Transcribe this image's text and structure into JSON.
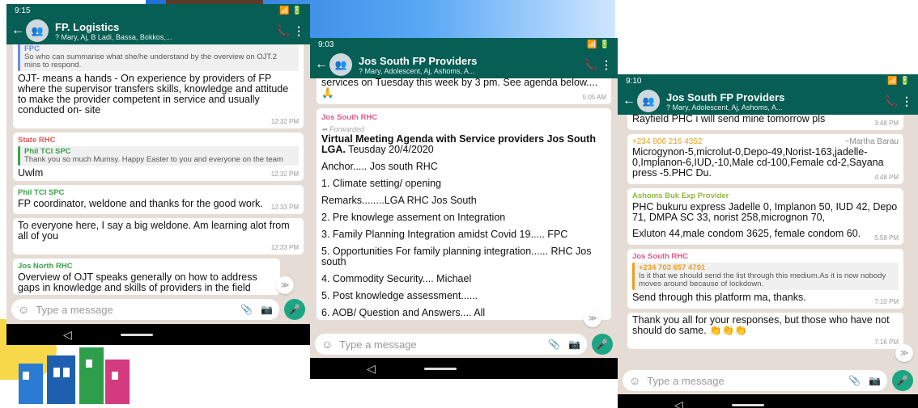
{
  "left": {
    "status_time": "9:15",
    "status_right": "ᵍᴼᴿᵃᴿ",
    "title": "FP. Logistics",
    "subtitle": "? Mary, Aj, B Ladi, Bassa, Bokkos,...",
    "m1_quote_sender": "FPC",
    "m1_quote": "So who can summarise what she/he understand by  the overview on OJT.2 mins to respond.",
    "m1_text": "OJT- means a hands - On experience by providers of FP where the supervisor transfers skills, knowledge and attitude to make the provider competent in service and usually conducted on- site",
    "m1_time": "12:32 PM",
    "m2_sender": "State RHC",
    "m2_quote_sender": "Phil TCI SPC",
    "m2_quote": "Thank you so much Mumsy. Happy Easter to you and everyone on the team",
    "m2_text": "Uwlm",
    "m2_time": "12:32 PM",
    "m3_sender": "Phil TCI SPC",
    "m3_text": "FP coordinator, weldone and thanks for the good work.",
    "m3_time": "12:33 PM",
    "m4_text": "To everyone here, I say a big weldone. Am learning alot from all of you",
    "m4_time": "12:33 PM",
    "m5_sender": "Jos North RHC",
    "m5_text": "Overview of OJT speaks generally on how to address gaps in knowledge and skills of providers in the field",
    "placeholder": "Type a message"
  },
  "middle": {
    "status_time": "9:03",
    "title": "Jos South FP Providers",
    "subtitle": "? Mary, Adolescent, Aj, Ashoms, A...",
    "m0_text": "services on Tuesday this week by 3 pm. See agenda below.... 🙏",
    "m0_time": "5:05 AM",
    "m1_sender": "Jos South RHC",
    "m1_fwd": "Forwarded",
    "m1_head": "Virtual Meeting Agenda with Service providers Jos South LGA.",
    "m1_date": "Teusday 20/4/2020",
    "items": [
      "Anchor..... Jos south RHC",
      "1. Climate setting/ opening",
      "Remarks........LGA RHC Jos South",
      "2. Pre knowlege  assement on Integration",
      "3.  Family Planning Integration amidst Covid 19.....  FPC",
      "5. Opportunities For family planning integration...... RHC Jos south",
      "4. Commodity Security.... Michael",
      "5. Post knowledge assessment......",
      "6.  AOB/ Question and Answers.... All"
    ],
    "placeholder": "Type a message"
  },
  "right": {
    "status_time": "9:10",
    "title": "Jos South FP Providers",
    "subtitle": "? Mary, Adolescent, Aj, Ashoms, A...",
    "m0_text": "Rayfield PHC i will send mine tomorrow pls",
    "m0_time": "3:48 PM",
    "m1_phone": "+234 806 216 4352",
    "m1_name": "~Martha Barau",
    "m1_text": "Microgynon-5,microlut-0,Depo-49,Norist-163,jadelle-0,Implanon-6,IUD,-10,Male cd-100,Female cd-2,Sayana press -5.PHC Du.",
    "m1_time": "4:48 PM",
    "m2_sender": "Ashoms Buk Exp Provider",
    "m2_text": "PHC  bukuru  express Jadelle 0, Implanon 50, IUD 42, Depo 71, DMPA SC 33, norist 258,micrognon 70,",
    "m2_text2": "Exluton 44,male condom 3625, female condom 60.",
    "m2_time": "5:58 PM",
    "m3_sender": "Jos South RHC",
    "m3_quote_sender": "+234 703 657 4791",
    "m3_quote": "Is it that we should send the list through this medium.As it is now nobody moves around because of lockdown.",
    "m3_text": "Send through this platform ma, thanks.",
    "m3_time": "7:10 PM",
    "m4_text": "Thank you all for your responses, but those who have not should do same. 👏👏👏",
    "m4_time": "7:16 PM",
    "placeholder": "Type a message"
  },
  "colors": {
    "header": "#075e54",
    "accent": "#1aa683",
    "chat_bg": "#e5ddd5"
  }
}
